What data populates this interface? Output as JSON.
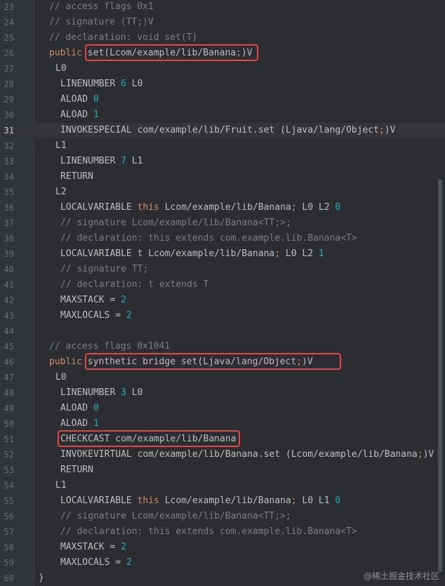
{
  "lines": [
    {
      "num": "23",
      "tokens": [
        {
          "t": "// access flags 0x1",
          "c": "cm"
        }
      ]
    },
    {
      "num": "24",
      "tokens": [
        {
          "t": "// signature (TT;)V",
          "c": "cm"
        }
      ]
    },
    {
      "num": "25",
      "tokens": [
        {
          "t": "// declaration: void set(T)",
          "c": "cm"
        }
      ]
    },
    {
      "num": "26",
      "tokens": [
        {
          "t": "public ",
          "c": "kw"
        },
        {
          "t": "set(Lcom/example/lib/Banana"
        },
        {
          "t": ";",
          "c": "sem"
        },
        {
          "t": ")V"
        }
      ]
    },
    {
      "num": "27",
      "tokens": [
        {
          "t": "L0"
        }
      ]
    },
    {
      "num": "28",
      "tokens": [
        {
          "t": "LINENUMBER "
        },
        {
          "t": "6",
          "c": "num"
        },
        {
          "t": " L0"
        }
      ]
    },
    {
      "num": "29",
      "tokens": [
        {
          "t": "ALOAD "
        },
        {
          "t": "0",
          "c": "num"
        }
      ]
    },
    {
      "num": "30",
      "tokens": [
        {
          "t": "ALOAD "
        },
        {
          "t": "1",
          "c": "num"
        }
      ]
    },
    {
      "num": "31",
      "tokens": [
        {
          "t": "INVOKESPECIAL com/example/lib/Fruit.set (Ljava/lang/Object"
        },
        {
          "t": ";",
          "c": "sem"
        },
        {
          "t": ")V"
        }
      ]
    },
    {
      "num": "32",
      "tokens": [
        {
          "t": "L1"
        }
      ]
    },
    {
      "num": "33",
      "tokens": [
        {
          "t": "LINENUMBER "
        },
        {
          "t": "7",
          "c": "num"
        },
        {
          "t": " L1"
        }
      ]
    },
    {
      "num": "34",
      "tokens": [
        {
          "t": "RETURN"
        }
      ]
    },
    {
      "num": "35",
      "tokens": [
        {
          "t": "L2"
        }
      ]
    },
    {
      "num": "36",
      "tokens": [
        {
          "t": "LOCALVARIABLE "
        },
        {
          "t": "this",
          "c": "kw"
        },
        {
          "t": " Lcom/example/lib/Banana"
        },
        {
          "t": ";",
          "c": "sem"
        },
        {
          "t": " L0 L2 "
        },
        {
          "t": "0",
          "c": "num"
        }
      ]
    },
    {
      "num": "37",
      "tokens": [
        {
          "t": "// signature Lcom/example/lib/Banana<TT;>;",
          "c": "cm"
        }
      ]
    },
    {
      "num": "38",
      "tokens": [
        {
          "t": "// declaration: this extends com.example.lib.Banana<T>",
          "c": "cm"
        }
      ]
    },
    {
      "num": "39",
      "tokens": [
        {
          "t": "LOCALVARIABLE t Lcom/example/lib/Banana"
        },
        {
          "t": ";",
          "c": "sem"
        },
        {
          "t": " L0 L2 "
        },
        {
          "t": "1",
          "c": "num"
        }
      ]
    },
    {
      "num": "40",
      "tokens": [
        {
          "t": "// signature TT;",
          "c": "cm"
        }
      ]
    },
    {
      "num": "41",
      "tokens": [
        {
          "t": "// declaration: t extends T",
          "c": "cm"
        }
      ]
    },
    {
      "num": "42",
      "tokens": [
        {
          "t": "MAXSTACK = "
        },
        {
          "t": "2",
          "c": "num"
        }
      ]
    },
    {
      "num": "43",
      "tokens": [
        {
          "t": "MAXLOCALS = "
        },
        {
          "t": "2",
          "c": "num"
        }
      ]
    },
    {
      "num": "44",
      "tokens": []
    },
    {
      "num": "45",
      "tokens": [
        {
          "t": "// access flags 0x1041",
          "c": "cm"
        }
      ]
    },
    {
      "num": "46",
      "tokens": [
        {
          "t": "public ",
          "c": "kw"
        },
        {
          "t": "synthetic bridge set(Ljava/lang/Object"
        },
        {
          "t": ";",
          "c": "sem"
        },
        {
          "t": ")V"
        }
      ]
    },
    {
      "num": "47",
      "tokens": [
        {
          "t": "L0"
        }
      ]
    },
    {
      "num": "48",
      "tokens": [
        {
          "t": "LINENUMBER "
        },
        {
          "t": "3",
          "c": "num"
        },
        {
          "t": " L0"
        }
      ]
    },
    {
      "num": "49",
      "tokens": [
        {
          "t": "ALOAD "
        },
        {
          "t": "0",
          "c": "num"
        }
      ]
    },
    {
      "num": "50",
      "tokens": [
        {
          "t": "ALOAD "
        },
        {
          "t": "1",
          "c": "num"
        }
      ]
    },
    {
      "num": "51",
      "tokens": [
        {
          "t": "CHECKCAST com/example/lib/Banana"
        }
      ]
    },
    {
      "num": "52",
      "tokens": [
        {
          "t": "INVOKEVIRTUAL com/example/lib/Banana.set (Lcom/example/lib/Banana"
        },
        {
          "t": ";",
          "c": "sem"
        },
        {
          "t": ")V"
        }
      ]
    },
    {
      "num": "53",
      "tokens": [
        {
          "t": "RETURN"
        }
      ]
    },
    {
      "num": "54",
      "tokens": [
        {
          "t": "L1"
        }
      ]
    },
    {
      "num": "55",
      "tokens": [
        {
          "t": "LOCALVARIABLE "
        },
        {
          "t": "this",
          "c": "kw"
        },
        {
          "t": " Lcom/example/lib/Banana"
        },
        {
          "t": ";",
          "c": "sem"
        },
        {
          "t": " L0 L1 "
        },
        {
          "t": "0",
          "c": "num"
        }
      ]
    },
    {
      "num": "56",
      "tokens": [
        {
          "t": "// signature Lcom/example/lib/Banana<TT;>;",
          "c": "cm"
        }
      ]
    },
    {
      "num": "57",
      "tokens": [
        {
          "t": "// declaration: this extends com.example.lib.Banana<T>",
          "c": "cm"
        }
      ]
    },
    {
      "num": "58",
      "tokens": [
        {
          "t": "MAXSTACK = "
        },
        {
          "t": "2",
          "c": "num"
        }
      ]
    },
    {
      "num": "59",
      "tokens": [
        {
          "t": "MAXLOCALS = "
        },
        {
          "t": "2",
          "c": "num"
        }
      ]
    },
    {
      "num": "60",
      "tokens": [
        {
          "t": "}"
        }
      ]
    }
  ],
  "current_line": "31",
  "highlighted_lines": [
    "26",
    "46",
    "51"
  ],
  "watermark": "@稀土掘金技术社区",
  "colors": {
    "keyword": "#cf8e6d",
    "comment": "#7a7e85",
    "number": "#2aacb8",
    "highlight_box": "#e04848"
  }
}
